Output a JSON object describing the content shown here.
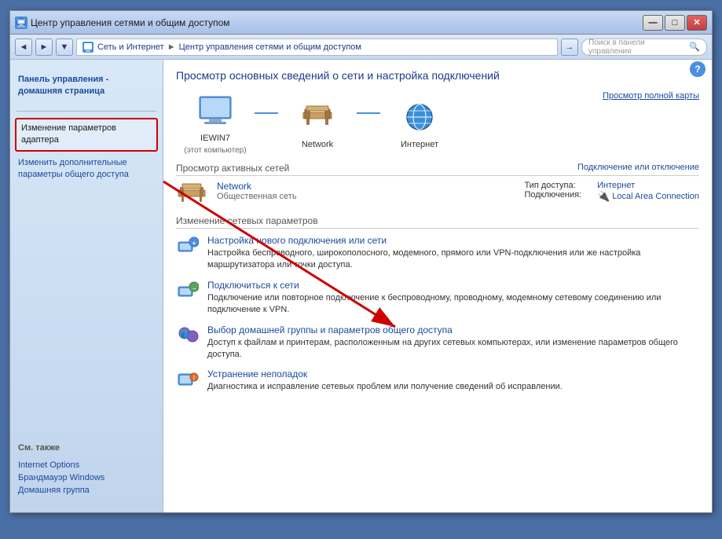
{
  "window": {
    "title": "Центр управления сетями и общим доступом",
    "minimize": "—",
    "maximize": "□",
    "close": "✕"
  },
  "addressbar": {
    "back": "◄",
    "forward": "►",
    "down": "▼",
    "breadcrumb": {
      "part1": "Сеть и Интернет",
      "sep1": "►",
      "part2": "Центр управления сетями и общим доступом"
    },
    "refresh": "→",
    "search_placeholder": "Поиск в панели управления"
  },
  "sidebar": {
    "home_label": "Панель управления - домашняя страница",
    "nav_items": [
      {
        "label": "Изменение параметров адаптера",
        "highlighted": true
      },
      {
        "label": "Изменить дополнительные параметры общего доступа",
        "highlighted": false
      }
    ],
    "also_label": "См. также",
    "links": [
      {
        "label": "Internet Options"
      },
      {
        "label": "Брандмауэр Windows"
      },
      {
        "label": "Домашняя группа"
      }
    ]
  },
  "content": {
    "title": "Просмотр основных сведений о сети и настройка подключений",
    "map_link": "Просмотр полной карты",
    "map_items": [
      {
        "name": "IEWIN7",
        "sublabel": "(этот компьютер)",
        "type": "computer"
      },
      {
        "name": "Network",
        "sublabel": "",
        "type": "bench"
      },
      {
        "name": "Интернет",
        "sublabel": "",
        "type": "globe"
      }
    ],
    "active_networks_label": "Просмотр активных сетей",
    "connect_disconnect": "Подключение или отключение",
    "network_name": "Network",
    "network_type": "Общественная сеть",
    "access_type_label": "Тип доступа:",
    "access_type_value": "Интернет",
    "connections_label": "Подключения:",
    "connections_value": "Local Area Connection",
    "change_section_label": "Изменение сетевых параметров",
    "actions": [
      {
        "title": "Настройка нового подключения или сети",
        "desc": "Настройка беспроводного, широкополосного, модемного, прямого или VPN-подключения или же настройка маршрутизатора или точки доступа.",
        "icon_type": "network-setup"
      },
      {
        "title": "Подключиться к сети",
        "desc": "Подключение или повторное подключение к беспроводному, проводному, модемному сетевому соединению или подключение к VPN.",
        "icon_type": "connect"
      },
      {
        "title": "Выбор домашней группы и параметров общего доступа",
        "desc": "Доступ к файлам и принтерам, расположенным на других сетевых компьютерах, или изменение параметров общего доступа.",
        "icon_type": "homegroup"
      },
      {
        "title": "Устранение неполадок",
        "desc": "Диагностика и исправление сетевых проблем или получение сведений об исправлении.",
        "icon_type": "troubleshoot"
      }
    ]
  }
}
